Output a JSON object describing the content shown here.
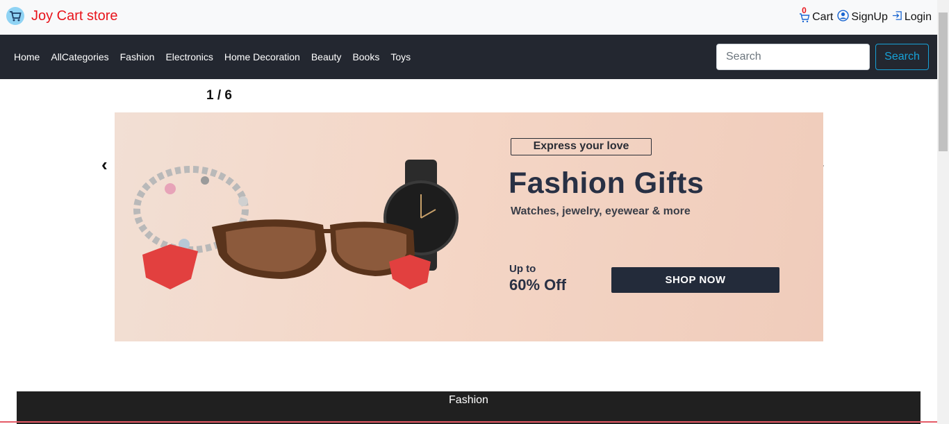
{
  "brand": {
    "name": "Joy Cart store"
  },
  "account": {
    "cart_label": "Cart",
    "cart_count": "0",
    "signup_label": "SignUp",
    "login_label": "Login"
  },
  "nav": {
    "links": [
      "Home",
      "AllCategories",
      "Fashion",
      "Electronics",
      "Home Decoration",
      "Beauty",
      "Books",
      "Toys"
    ],
    "search_placeholder": "Search",
    "search_button": "Search"
  },
  "slider": {
    "counter": "1 / 6",
    "prev": "‹",
    "next": "›",
    "banner": {
      "tag": "Express your love",
      "headline": "Fashion Gifts",
      "subline": "Watches, jewelry, eyewear & more",
      "upto": "Up to",
      "discount": "60% Off",
      "cta": "SHOP NOW"
    }
  },
  "section": {
    "title": "Fashion"
  },
  "colors": {
    "brand": "#e8141b",
    "navbar": "#232730",
    "search_accent": "#17a2d8",
    "section_bar": "#202020"
  },
  "icons": {
    "logo": "shopping-cart-logo-icon",
    "cart": "cart-icon",
    "signup": "user-circle-icon",
    "login": "login-icon"
  }
}
